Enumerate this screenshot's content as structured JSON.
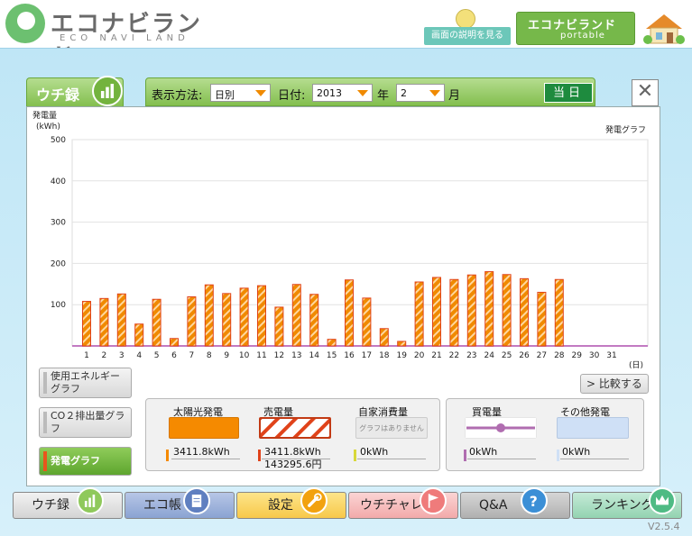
{
  "header": {
    "logo_title": "エコナビランド",
    "logo_subtitle": "ECO NAVI LAND",
    "help_button": "画面の説明を見る",
    "portable_title": "エコナビランド",
    "portable_sub": "portable"
  },
  "tab": {
    "label": "ウチ録"
  },
  "toolbar": {
    "display_label": "表示方法:",
    "display_value": "日別",
    "date_label": "日付:",
    "year_value": "2013",
    "year_unit": "年",
    "month_value": "2",
    "month_unit": "月",
    "today_button": "当日"
  },
  "close_label": "✕",
  "chart_data": {
    "type": "bar",
    "title": "発電グラフ",
    "ylabel": "発電量",
    "yunit": "(kWh)",
    "xunit": "(日)",
    "ylim": [
      0,
      500
    ],
    "yticks": [
      "500",
      "400",
      "300",
      "200",
      "100"
    ],
    "categories": [
      "1",
      "2",
      "3",
      "4",
      "5",
      "6",
      "7",
      "8",
      "9",
      "10",
      "11",
      "12",
      "13",
      "14",
      "15",
      "16",
      "17",
      "18",
      "19",
      "20",
      "21",
      "22",
      "23",
      "24",
      "25",
      "26",
      "27",
      "28",
      "29",
      "30",
      "31"
    ],
    "series": [
      {
        "values": [
          108,
          115,
          126,
          53,
          113,
          18,
          119,
          148,
          127,
          140,
          146,
          94,
          149,
          125,
          16,
          160,
          116,
          42,
          11,
          155,
          166,
          161,
          172,
          180,
          173,
          163,
          130,
          161,
          0,
          0,
          0
        ]
      }
    ],
    "colors": {
      "bar_fill": "#f08a00",
      "bar_hatch": "#e0431a"
    }
  },
  "side_buttons": [
    {
      "label": "使用エネルギーグラフ"
    },
    {
      "label": "CO２排出量グラフ"
    },
    {
      "label": "発電グラフ"
    }
  ],
  "compare_button": "比較する",
  "legend": {
    "solar_title": "太陽光発電",
    "solar_value": "3411.8kWh",
    "sold_title": "売電量",
    "sold_value": "3411.8kWh",
    "sold_yen": "143295.6円",
    "self_title": "自家消費量",
    "self_box": "グラフはありません",
    "self_value": "0kWh",
    "buy_title": "買電量",
    "buy_value": "0kWh",
    "other_title": "その他発電",
    "other_value": "0kWh"
  },
  "bottom_nav": [
    {
      "label": "ウチ録"
    },
    {
      "label": "エコ帳"
    },
    {
      "label": "設定"
    },
    {
      "label": "ウチチャレ"
    },
    {
      "label": "Q&A"
    },
    {
      "label": "ランキング"
    }
  ],
  "version": "V2.5.4"
}
